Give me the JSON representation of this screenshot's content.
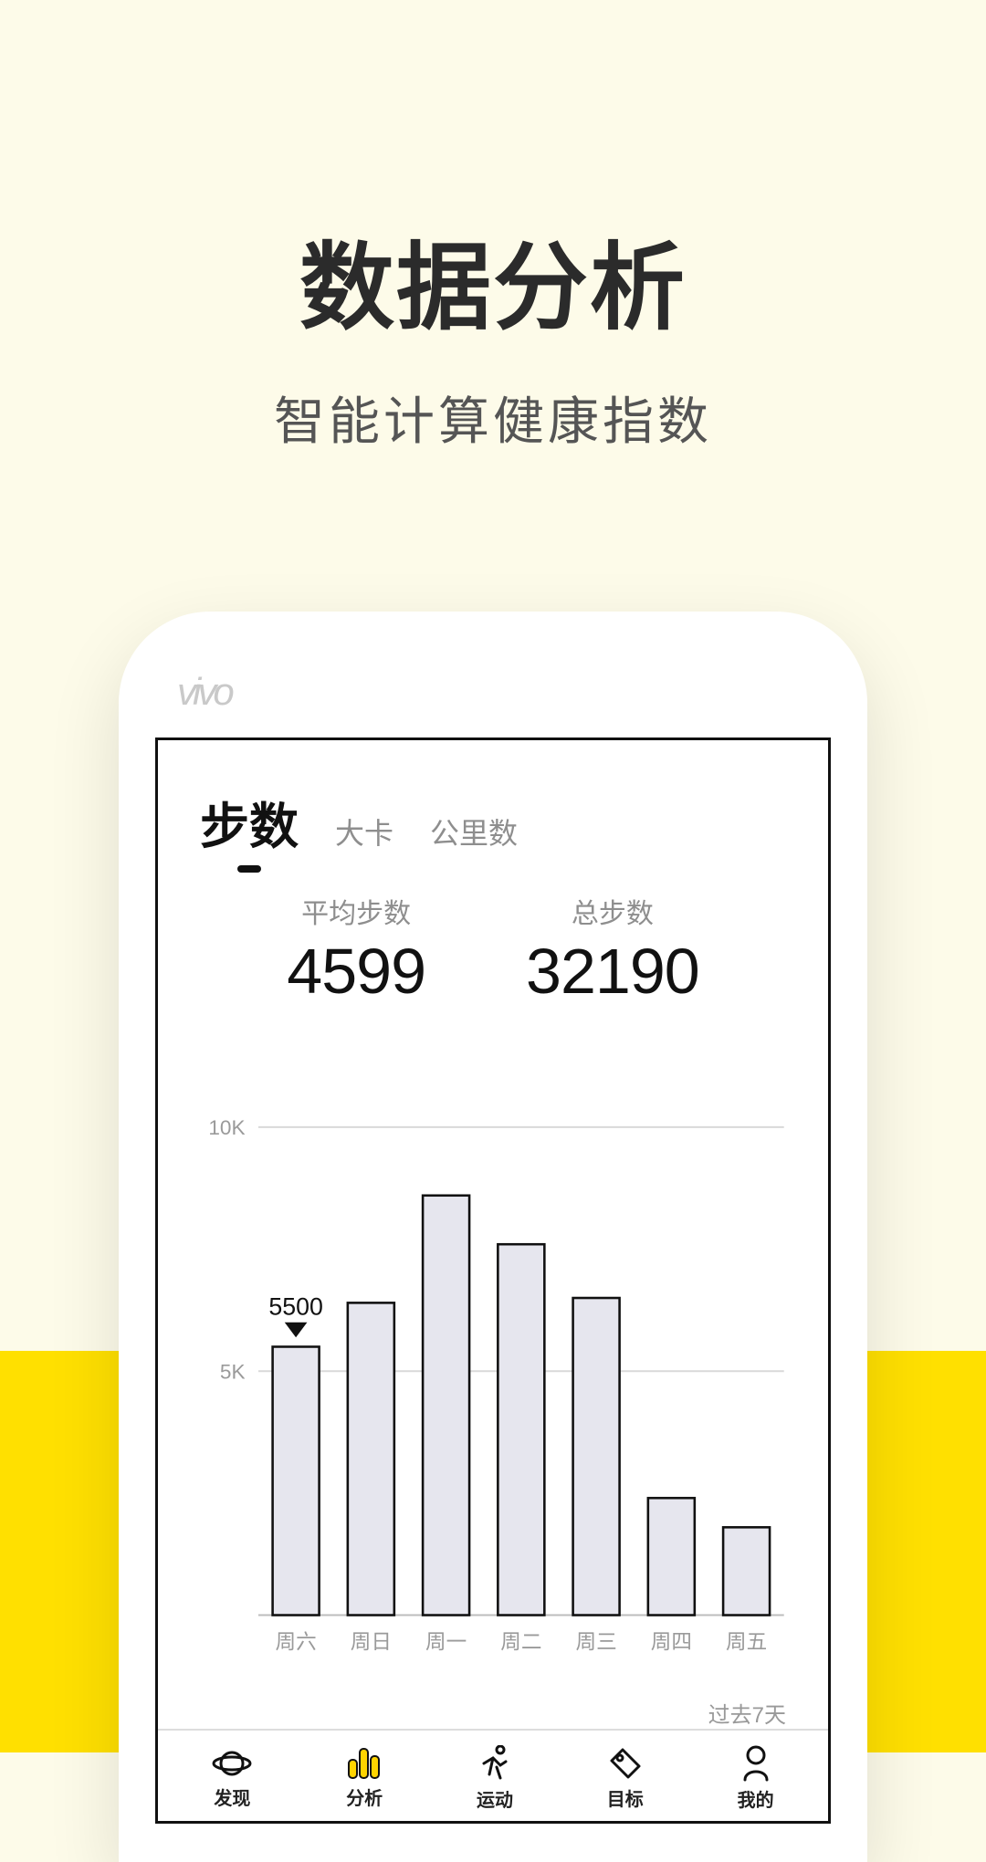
{
  "header": {
    "title": "数据分析",
    "subtitle": "智能计算健康指数"
  },
  "phone": {
    "brand": "vivo"
  },
  "tabs": [
    {
      "label": "步数",
      "active": true
    },
    {
      "label": "大卡",
      "active": false
    },
    {
      "label": "公里数",
      "active": false
    }
  ],
  "stats": {
    "avg_label": "平均步数",
    "avg_value": "4599",
    "total_label": "总步数",
    "total_value": "32190"
  },
  "chart_data": {
    "type": "bar",
    "categories": [
      "周六",
      "周日",
      "周一",
      "周二",
      "周三",
      "周四",
      "周五"
    ],
    "values": [
      5500,
      6400,
      8600,
      7600,
      6500,
      2400,
      1800
    ],
    "data_label_index": 0,
    "data_label_value": "5500",
    "y_ticks": [
      "5K",
      "10K"
    ],
    "ylim": [
      0,
      10000
    ],
    "period_label": "过去7天"
  },
  "nav": [
    {
      "label": "发现"
    },
    {
      "label": "分析"
    },
    {
      "label": "运动"
    },
    {
      "label": "目标"
    },
    {
      "label": "我的"
    }
  ]
}
